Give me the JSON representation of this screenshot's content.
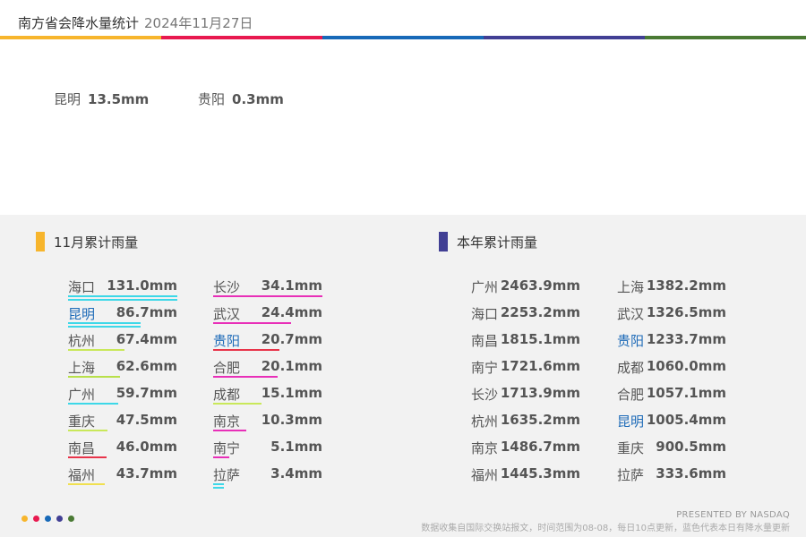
{
  "header": {
    "title": "南方省会降水量统计",
    "date": "2024年11月27日"
  },
  "colors": {
    "stripe": [
      "#f7b52c",
      "#e8194f",
      "#1769b8",
      "#413f94",
      "#4a7a34"
    ],
    "blue_text": "#1e6bb8",
    "marker_monthly": "#f7b52c",
    "marker_yearly": "#413f94"
  },
  "today": [
    {
      "city": "昆明",
      "value": "13.5mm"
    },
    {
      "city": "贵阳",
      "value": "0.3mm"
    }
  ],
  "monthly": {
    "title": "11月累计雨量",
    "unit": "mm",
    "items": [
      {
        "city": "海口",
        "value": 131.0,
        "label": "131.0mm",
        "bar": "#3dd8e8",
        "double": true
      },
      {
        "city": "昆明",
        "value": 86.7,
        "label": "86.7mm",
        "bar": "#3dd8e8",
        "double": true,
        "blue": true
      },
      {
        "city": "杭州",
        "value": 67.4,
        "label": "67.4mm",
        "bar": "#c9e85a"
      },
      {
        "city": "上海",
        "value": 62.6,
        "label": "62.6mm",
        "bar": "#b8e04a"
      },
      {
        "city": "广州",
        "value": 59.7,
        "label": "59.7mm",
        "bar": "#3dd8e8"
      },
      {
        "city": "重庆",
        "value": 47.5,
        "label": "47.5mm",
        "bar": "#c9e85a"
      },
      {
        "city": "南昌",
        "value": 46.0,
        "label": "46.0mm",
        "bar": "#e8344a"
      },
      {
        "city": "福州",
        "value": 43.7,
        "label": "43.7mm",
        "bar": "#f0e050"
      },
      {
        "city": "长沙",
        "value": 34.1,
        "label": "34.1mm",
        "bar": "#e82fb8"
      },
      {
        "city": "武汉",
        "value": 24.4,
        "label": "24.4mm",
        "bar": "#e82fb8"
      },
      {
        "city": "贵阳",
        "value": 20.7,
        "label": "20.7mm",
        "bar": "#e8344a",
        "blue": true
      },
      {
        "city": "合肥",
        "value": 20.1,
        "label": "20.1mm",
        "bar": "#e82fb8"
      },
      {
        "city": "成都",
        "value": 15.1,
        "label": "15.1mm",
        "bar": "#c9e85a"
      },
      {
        "city": "南京",
        "value": 10.3,
        "label": "10.3mm",
        "bar": "#e82fb8"
      },
      {
        "city": "南宁",
        "value": 5.1,
        "label": "5.1mm",
        "bar": "#e82fb8"
      },
      {
        "city": "拉萨",
        "value": 3.4,
        "label": "3.4mm",
        "bar": "#3dd8e8",
        "double": true
      }
    ]
  },
  "yearly": {
    "title": "本年累计雨量",
    "unit": "mm",
    "items": [
      {
        "city": "广州",
        "value": 2463.9,
        "label": "2463.9mm"
      },
      {
        "city": "海口",
        "value": 2253.2,
        "label": "2253.2mm"
      },
      {
        "city": "南昌",
        "value": 1815.1,
        "label": "1815.1mm"
      },
      {
        "city": "南宁",
        "value": 1721.6,
        "label": "1721.6mm"
      },
      {
        "city": "长沙",
        "value": 1713.9,
        "label": "1713.9mm"
      },
      {
        "city": "杭州",
        "value": 1635.2,
        "label": "1635.2mm"
      },
      {
        "city": "南京",
        "value": 1486.7,
        "label": "1486.7mm"
      },
      {
        "city": "福州",
        "value": 1445.3,
        "label": "1445.3mm"
      },
      {
        "city": "上海",
        "value": 1382.2,
        "label": "1382.2mm"
      },
      {
        "city": "武汉",
        "value": 1326.5,
        "label": "1326.5mm"
      },
      {
        "city": "贵阳",
        "value": 1233.7,
        "label": "1233.7mm",
        "blue": true
      },
      {
        "city": "成都",
        "value": 1060.0,
        "label": "1060.0mm"
      },
      {
        "city": "合肥",
        "value": 1057.1,
        "label": "1057.1mm"
      },
      {
        "city": "昆明",
        "value": 1005.4,
        "label": "1005.4mm",
        "blue": true
      },
      {
        "city": "重庆",
        "value": 900.5,
        "label": "900.5mm"
      },
      {
        "city": "拉萨",
        "value": 333.6,
        "label": "333.6mm"
      }
    ]
  },
  "footer": {
    "dots": [
      "#f7b52c",
      "#e8194f",
      "#1769b8",
      "#413f94",
      "#4a7a34"
    ],
    "presented": "PRESENTED BY NASDAQ",
    "note": "数据收集自国际交换站报文，时间范围为08-08，每日10点更新，蓝色代表本日有降水量更新"
  },
  "chart_data": {
    "type": "table",
    "tables": [
      {
        "title": "11月累计雨量",
        "unit": "mm",
        "categories": [
          "海口",
          "昆明",
          "杭州",
          "上海",
          "广州",
          "重庆",
          "南昌",
          "福州",
          "长沙",
          "武汉",
          "贵阳",
          "合肥",
          "成都",
          "南京",
          "南宁",
          "拉萨"
        ],
        "values": [
          131.0,
          86.7,
          67.4,
          62.6,
          59.7,
          47.5,
          46.0,
          43.7,
          34.1,
          24.4,
          20.7,
          20.1,
          15.1,
          10.3,
          5.1,
          3.4
        ]
      },
      {
        "title": "本年累计雨量",
        "unit": "mm",
        "categories": [
          "广州",
          "海口",
          "南昌",
          "南宁",
          "长沙",
          "杭州",
          "南京",
          "福州",
          "上海",
          "武汉",
          "贵阳",
          "成都",
          "合肥",
          "昆明",
          "重庆",
          "拉萨"
        ],
        "values": [
          2463.9,
          2253.2,
          1815.1,
          1721.6,
          1713.9,
          1635.2,
          1486.7,
          1445.3,
          1382.2,
          1326.5,
          1233.7,
          1060.0,
          1057.1,
          1005.4,
          900.5,
          333.6
        ]
      }
    ]
  }
}
